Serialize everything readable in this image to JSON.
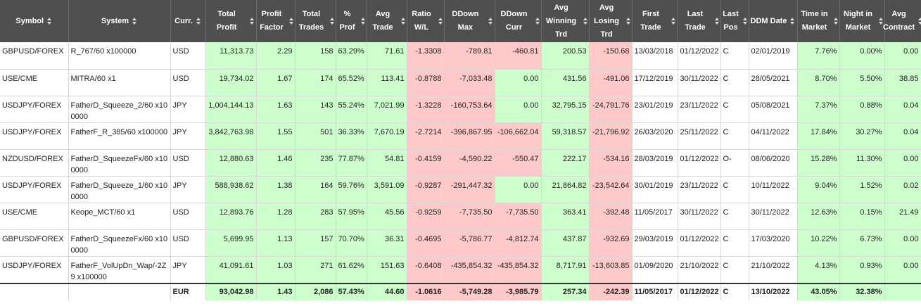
{
  "colors": {
    "header_bg": "#4f4f4f",
    "header_text": "#ffffff",
    "positive": "#ccffcc",
    "negative": "#ffc9c9"
  },
  "columns": [
    {
      "key": "symbol",
      "label": "Symbol"
    },
    {
      "key": "system",
      "label": "System"
    },
    {
      "key": "curr",
      "label": "Curr."
    },
    {
      "key": "total_profit",
      "label": "Total Profit"
    },
    {
      "key": "profit_factor",
      "label": "Profit Factor"
    },
    {
      "key": "total_trades",
      "label": "Total Trades"
    },
    {
      "key": "pct_prof",
      "label": "% Prof"
    },
    {
      "key": "avg_trade",
      "label": "Avg Trade"
    },
    {
      "key": "ratio_wl",
      "label": "Ratio W/L"
    },
    {
      "key": "ddown_max",
      "label": "DDown Max"
    },
    {
      "key": "ddown_curr",
      "label": "DDown Curr"
    },
    {
      "key": "avg_win",
      "label": "Avg Winning Trd"
    },
    {
      "key": "avg_loss",
      "label": "Avg Losing Trd"
    },
    {
      "key": "first_trade",
      "label": "First Trade"
    },
    {
      "key": "last_trade",
      "label": "Last Trade"
    },
    {
      "key": "last_pos",
      "label": "Last Pos"
    },
    {
      "key": "ddm_date",
      "label": "DDM Date"
    },
    {
      "key": "time_in_market",
      "label": "Time in Market"
    },
    {
      "key": "night_in_market",
      "label": "Night in Market"
    },
    {
      "key": "avg_contract",
      "label": "Avg Contract"
    }
  ],
  "rows": [
    {
      "symbol": "GBPUSD/FOREX",
      "system": "R_767/60 x100000",
      "curr": "USD",
      "total_profit": "11,313.73",
      "profit_factor": "2.29",
      "total_trades": "158",
      "pct_prof": "63.29%",
      "avg_trade": "71.61",
      "ratio_wl": "-1.3308",
      "ddown_max": "-789.81",
      "ddown_curr": "-460.81",
      "avg_win": "200.53",
      "avg_loss": "-150.68",
      "first_trade": "13/03/2018",
      "last_trade": "01/12/2022",
      "last_pos": "C",
      "ddm_date": "02/01/2019",
      "time_in_market": "7.76%",
      "night_in_market": "0.00%",
      "avg_contract": "0.00"
    },
    {
      "symbol": "USE/CME",
      "system": "MITRA/60 x1",
      "curr": "USD",
      "total_profit": "19,734.02",
      "profit_factor": "1.67",
      "total_trades": "174",
      "pct_prof": "65.52%",
      "avg_trade": "113.41",
      "ratio_wl": "-0.8788",
      "ddown_max": "-7,033.48",
      "ddown_curr": "0.00",
      "avg_win": "431.56",
      "avg_loss": "-491.06",
      "first_trade": "17/12/2019",
      "last_trade": "30/11/2022",
      "last_pos": "C",
      "ddm_date": "28/05/2021",
      "time_in_market": "8.70%",
      "night_in_market": "5.50%",
      "avg_contract": "38.85"
    },
    {
      "symbol": "USDJPY/FOREX",
      "system": "FatherD_Squeeze_2/60 x100000",
      "curr": "JPY",
      "total_profit": "1,004,144.13",
      "profit_factor": "1.63",
      "total_trades": "143",
      "pct_prof": "55.24%",
      "avg_trade": "7,021.99",
      "ratio_wl": "-1.3228",
      "ddown_max": "-160,753.64",
      "ddown_curr": "0.00",
      "avg_win": "32,795.15",
      "avg_loss": "-24,791.76",
      "first_trade": "23/01/2019",
      "last_trade": "23/11/2022",
      "last_pos": "C",
      "ddm_date": "05/08/2021",
      "time_in_market": "7.37%",
      "night_in_market": "0.88%",
      "avg_contract": "0.04"
    },
    {
      "symbol": "USDJPY/FOREX",
      "system": "FatherF_R_385/60 x100000",
      "curr": "JPY",
      "total_profit": "3,842,763.98",
      "profit_factor": "1.55",
      "total_trades": "501",
      "pct_prof": "36.33%",
      "avg_trade": "7,670.19",
      "ratio_wl": "-2.7214",
      "ddown_max": "-396,867.95",
      "ddown_curr": "-106,662.04",
      "avg_win": "59,318.57",
      "avg_loss": "-21,796.92",
      "first_trade": "26/03/2020",
      "last_trade": "25/11/2022",
      "last_pos": "C",
      "ddm_date": "04/11/2022",
      "time_in_market": "17.84%",
      "night_in_market": "30.27%",
      "avg_contract": "0.04"
    },
    {
      "symbol": "NZDUSD/FOREX",
      "system": "FatherD_SqueezeFx/60 x100000",
      "curr": "USD",
      "total_profit": "12,880.63",
      "profit_factor": "1.46",
      "total_trades": "235",
      "pct_prof": "77.87%",
      "avg_trade": "54.81",
      "ratio_wl": "-0.4159",
      "ddown_max": "-4,590.22",
      "ddown_curr": "-550.47",
      "avg_win": "222.17",
      "avg_loss": "-534.16",
      "first_trade": "28/03/2019",
      "last_trade": "01/12/2022",
      "last_pos": "O-",
      "ddm_date": "08/06/2020",
      "time_in_market": "15.28%",
      "night_in_market": "11.30%",
      "avg_contract": "0.00"
    },
    {
      "symbol": "USDJPY/FOREX",
      "system": "FatherD_Squeeze_1/60 x100000",
      "curr": "JPY",
      "total_profit": "588,938.62",
      "profit_factor": "1.38",
      "total_trades": "164",
      "pct_prof": "59.76%",
      "avg_trade": "3,591.09",
      "ratio_wl": "-0.9287",
      "ddown_max": "-291,447.32",
      "ddown_curr": "0.00",
      "avg_win": "21,864.82",
      "avg_loss": "-23,542.64",
      "first_trade": "30/01/2019",
      "last_trade": "23/11/2022",
      "last_pos": "C",
      "ddm_date": "10/11/2022",
      "time_in_market": "9.04%",
      "night_in_market": "1.52%",
      "avg_contract": "0.02"
    },
    {
      "symbol": "USE/CME",
      "system": "Keope_MCT/60 x1",
      "curr": "USD",
      "total_profit": "12,893.76",
      "profit_factor": "1.28",
      "total_trades": "283",
      "pct_prof": "57.95%",
      "avg_trade": "45.56",
      "ratio_wl": "-0.9259",
      "ddown_max": "-7,735.50",
      "ddown_curr": "-7,735.50",
      "avg_win": "363.41",
      "avg_loss": "-392.48",
      "first_trade": "11/05/2017",
      "last_trade": "30/11/2022",
      "last_pos": "C",
      "ddm_date": "30/11/2022",
      "time_in_market": "12.63%",
      "night_in_market": "0.15%",
      "avg_contract": "21.49"
    },
    {
      "symbol": "GBPUSD/FOREX",
      "system": "FatherD_SqueezeFx/60 x100000",
      "curr": "USD",
      "total_profit": "5,699.95",
      "profit_factor": "1.13",
      "total_trades": "157",
      "pct_prof": "70.70%",
      "avg_trade": "36.31",
      "ratio_wl": "-0.4695",
      "ddown_max": "-5,786.77",
      "ddown_curr": "-4,812.74",
      "avg_win": "437.87",
      "avg_loss": "-932.69",
      "first_trade": "29/03/2019",
      "last_trade": "01/12/2022",
      "last_pos": "C",
      "ddm_date": "17/03/2020",
      "time_in_market": "10.22%",
      "night_in_market": "6.73%",
      "avg_contract": "0.00"
    },
    {
      "symbol": "USDJPY/FOREX",
      "system": "FatherF_VolUpDn_Wap/-2Z9 x100000",
      "curr": "JPY",
      "total_profit": "41,091.61",
      "profit_factor": "1.03",
      "total_trades": "271",
      "pct_prof": "61.62%",
      "avg_trade": "151.63",
      "ratio_wl": "-0.6408",
      "ddown_max": "-435,854.32",
      "ddown_curr": "-435,854.32",
      "avg_win": "8,717.91",
      "avg_loss": "-13,603.85",
      "first_trade": "01/09/2020",
      "last_trade": "21/10/2022",
      "last_pos": "C",
      "ddm_date": "21/10/2022",
      "time_in_market": "4.13%",
      "night_in_market": "0.93%",
      "avg_contract": "0.00"
    }
  ],
  "total": {
    "symbol": "",
    "system": "",
    "curr": "EUR",
    "total_profit": "93,042.98",
    "profit_factor": "1.43",
    "total_trades": "2,086",
    "pct_prof": "57.43%",
    "avg_trade": "44.60",
    "ratio_wl": "-1.0616",
    "ddown_max": "-5,749.28",
    "ddown_curr": "-3,985.79",
    "avg_win": "257.34",
    "avg_loss": "-242.39",
    "first_trade": "11/05/2017",
    "last_trade": "01/12/2022",
    "last_pos": "C",
    "ddm_date": "13/10/2022",
    "time_in_market": "43.05%",
    "night_in_market": "32.38%",
    "avg_contract": ""
  }
}
